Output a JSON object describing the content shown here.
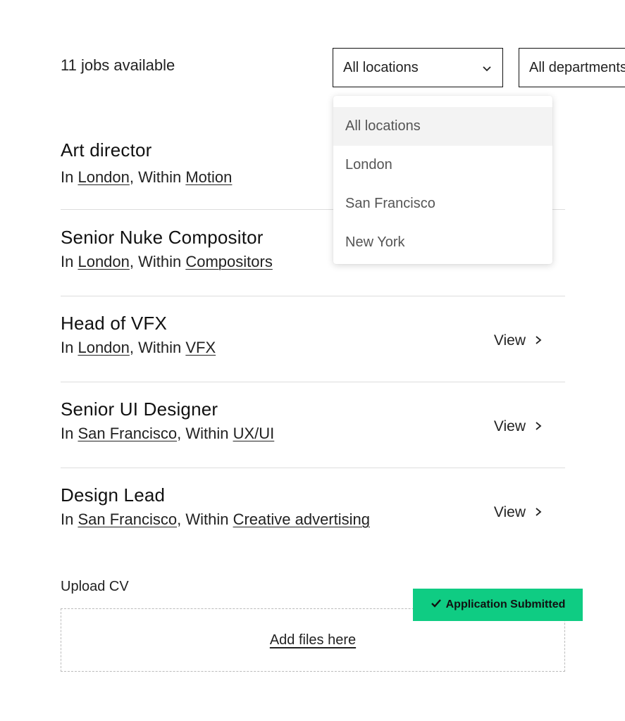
{
  "header": {
    "jobs_count": "11 jobs available"
  },
  "filters": {
    "location": {
      "selected": "All locations",
      "options": [
        "All locations",
        "London",
        "San Francisco",
        "New York"
      ]
    },
    "department": {
      "selected": "All departments"
    }
  },
  "jobs": [
    {
      "title": "Art director",
      "prefix": "In ",
      "location": "London",
      "sep": ", Within ",
      "department": "Motion",
      "view": ""
    },
    {
      "title": "Senior Nuke Compositor",
      "prefix": "In ",
      "location": "London",
      "sep": ", Within ",
      "department": "Compositors",
      "view": ""
    },
    {
      "title": "Head of VFX",
      "prefix": "In ",
      "location": "London",
      "sep": ", Within ",
      "department": "VFX",
      "view": "View"
    },
    {
      "title": "Senior UI Designer",
      "prefix": "In ",
      "location": "San Francisco",
      "sep": ", Within ",
      "department": "UX/UI",
      "view": "View"
    },
    {
      "title": "Design Lead",
      "prefix": "In ",
      "location": "San Francisco",
      "sep": ", Within ",
      "department": "Creative advertising",
      "view": "View"
    }
  ],
  "upload": {
    "label": "Upload CV",
    "add_files": "Add files here"
  },
  "toast": {
    "message": "Application Submitted",
    "color": "#0fcc83"
  },
  "icons": {
    "select_chevron": "chevron-down-icon",
    "view_chevron": "chevron-right-icon",
    "toast_check": "check-icon"
  }
}
